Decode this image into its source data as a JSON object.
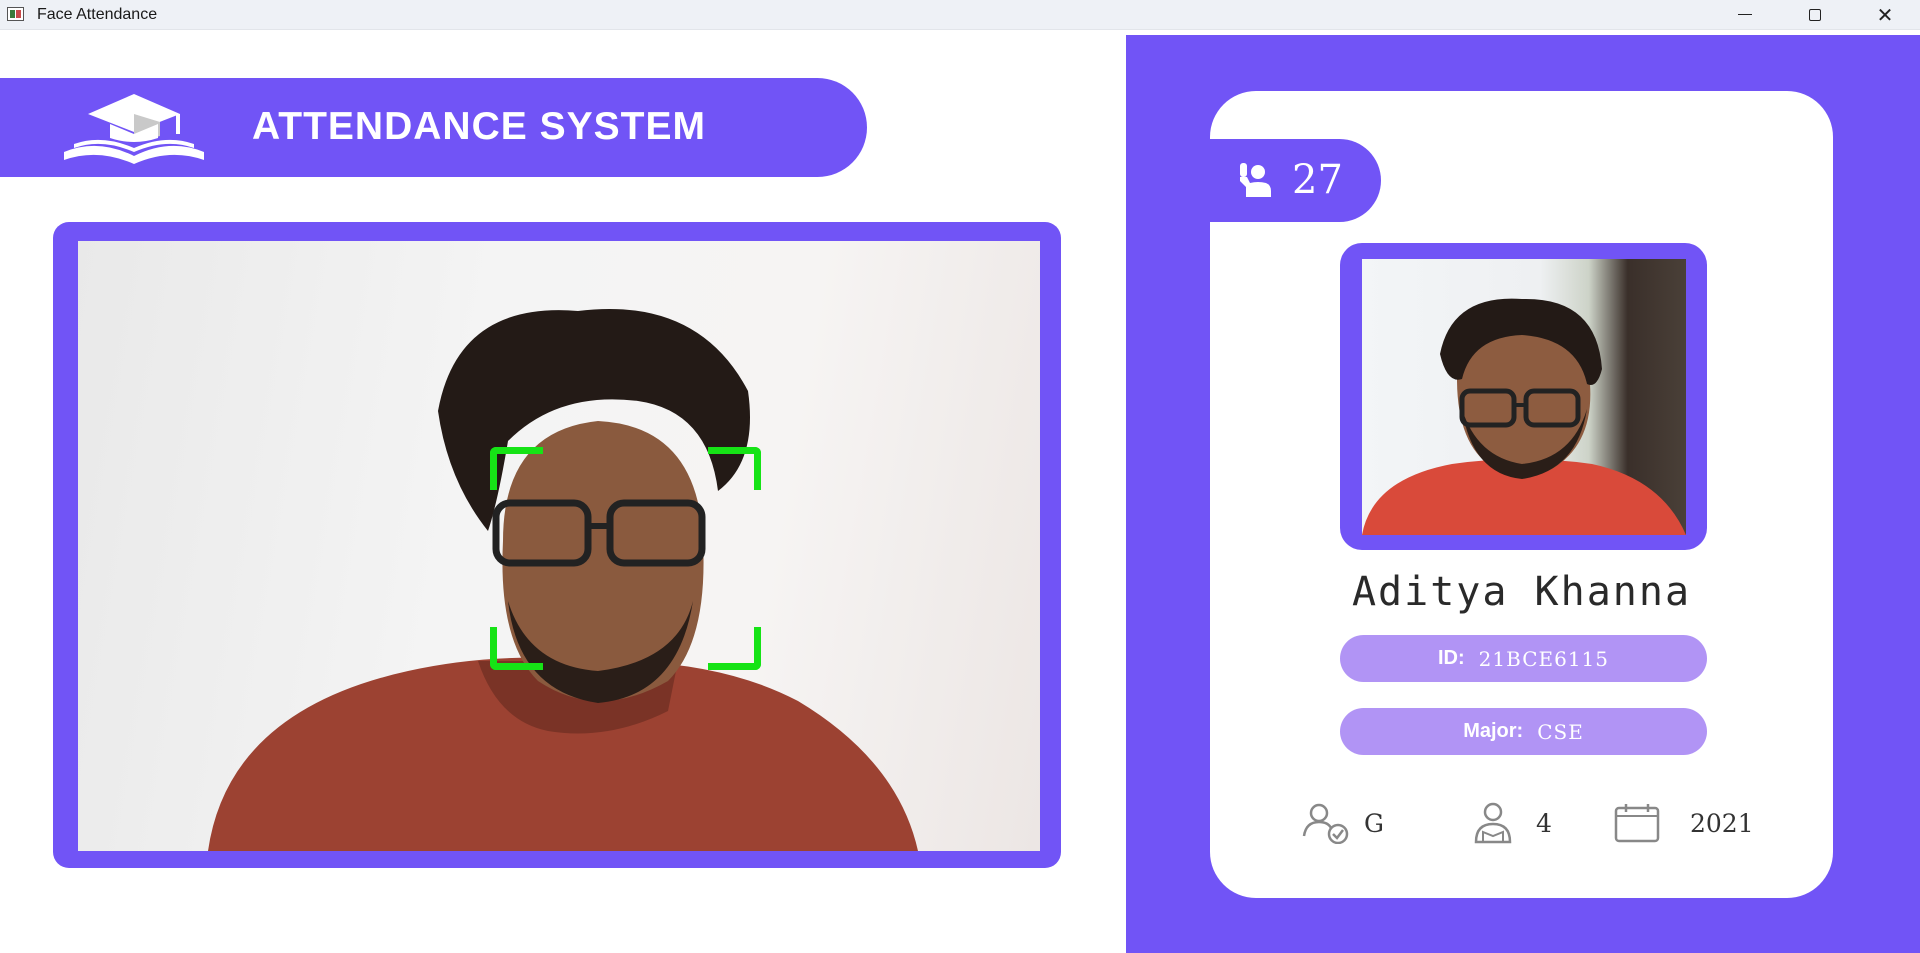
{
  "window": {
    "title": "Face Attendance",
    "controls": [
      "minimize",
      "maximize",
      "close"
    ],
    "close_glyph": "✕"
  },
  "header": {
    "title": "ATTENDANCE SYSTEM",
    "logo_icon": "graduation-cap-book-icon"
  },
  "camera": {
    "face_detection_box_color": "#16e316"
  },
  "student": {
    "total_attendance": "27",
    "name": "Aditya Khanna",
    "id_label": "ID:",
    "id_value": "21BCE6115",
    "major_label": "Major:",
    "major_value": "CSE",
    "standing": "G",
    "year": "4",
    "starting_year": "2021"
  },
  "icons": {
    "attendance": "person-raised-hand-icon",
    "standing": "user-check-icon",
    "year": "student-reading-icon",
    "starting_year": "calendar-icon"
  },
  "colors": {
    "accent": "#7154f6",
    "pill": "#b194f5",
    "background": "#ffffff"
  }
}
